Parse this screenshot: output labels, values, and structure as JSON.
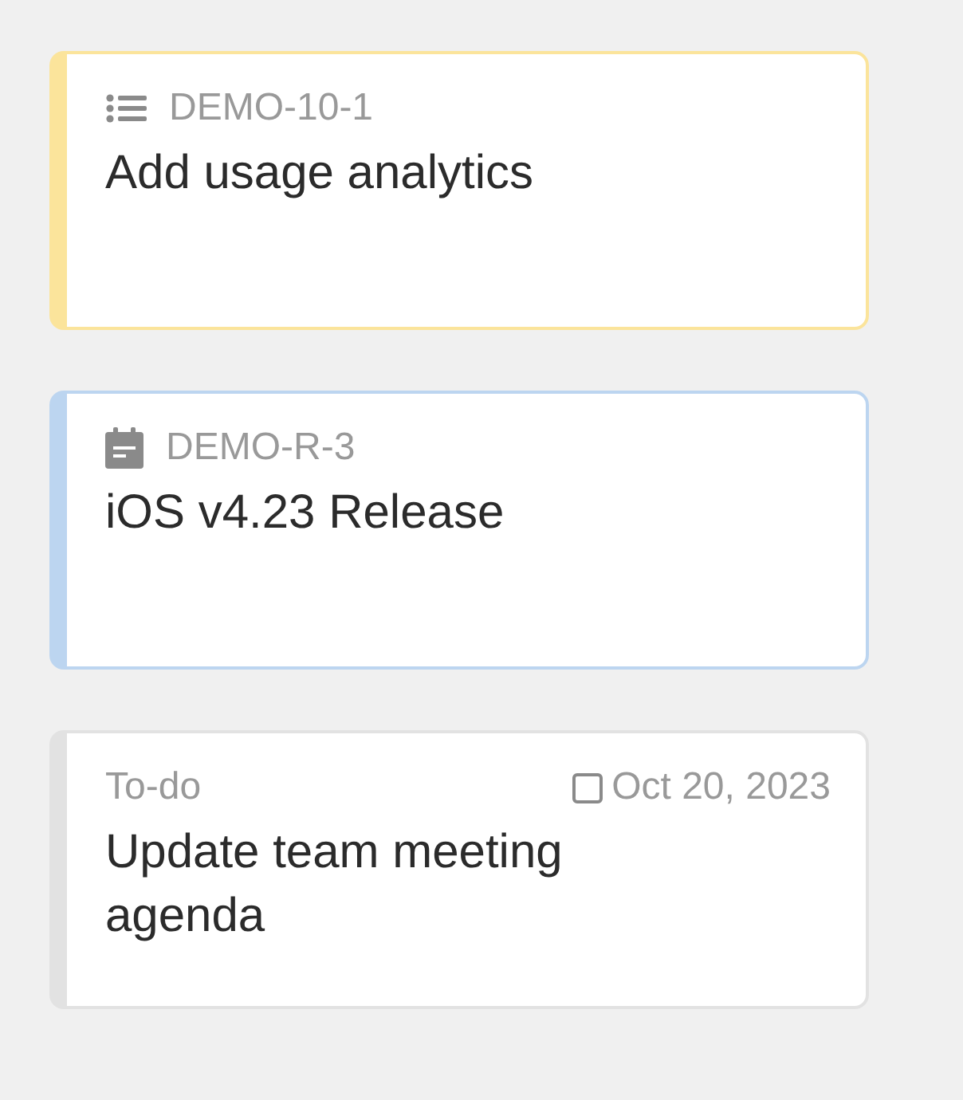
{
  "cards": [
    {
      "kind": "task",
      "color": "#fbe49b",
      "key": "DEMO-10-1",
      "title": "Add usage analytics"
    },
    {
      "kind": "release",
      "color": "#bcd5f0",
      "key": "DEMO-R-3",
      "title": "iOS v4.23 Release"
    },
    {
      "kind": "todo",
      "color": "#e2e2e2",
      "status": "To-do",
      "checked": false,
      "date": "Oct 20, 2023",
      "title": "Update team meeting agenda"
    }
  ]
}
